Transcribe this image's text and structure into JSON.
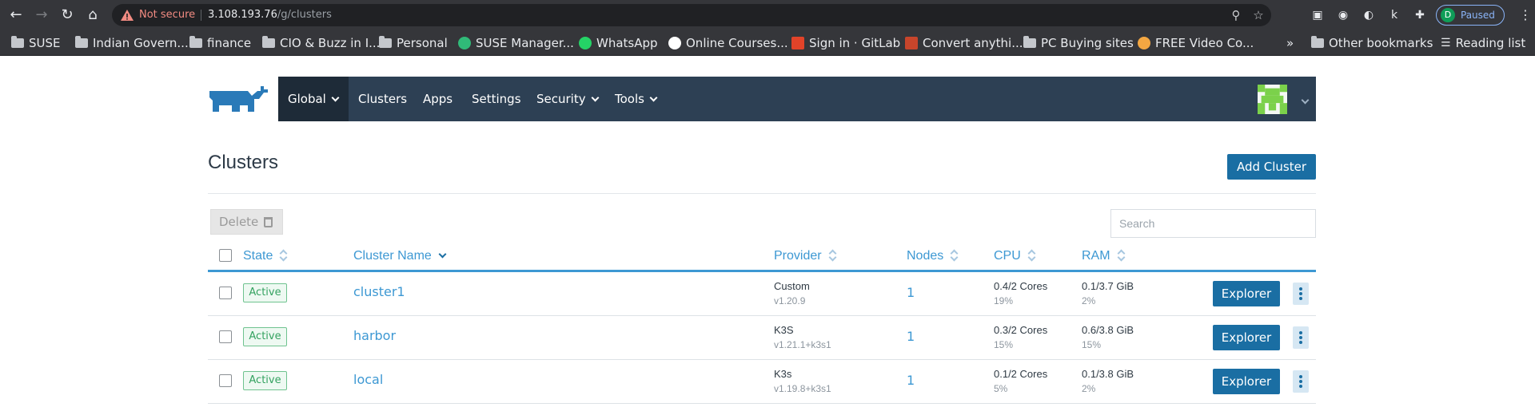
{
  "browser": {
    "security_label": "Not secure",
    "url_host": "3.108.193.76",
    "url_path": "/g/clusters",
    "profile_initial": "D",
    "profile_status": "Paused",
    "bookmarks": [
      {
        "label": "SUSE",
        "icon": "folder-icon"
      },
      {
        "label": "Indian Govern...",
        "icon": "folder-icon"
      },
      {
        "label": "finance",
        "icon": "folder-icon"
      },
      {
        "label": "CIO & Buzz in I...",
        "icon": "folder-icon"
      },
      {
        "label": "Personal",
        "icon": "folder-icon"
      },
      {
        "label": "SUSE Manager...",
        "icon": "suse-icon"
      },
      {
        "label": "WhatsApp",
        "icon": "whatsapp-icon"
      },
      {
        "label": "Online Courses...",
        "icon": "udemy-icon"
      },
      {
        "label": "Sign in · GitLab",
        "icon": "gitlab-icon"
      },
      {
        "label": "Convert anythi...",
        "icon": "pdf-icon"
      },
      {
        "label": "PC Buying sites",
        "icon": "folder-icon"
      },
      {
        "label": "FREE Video Co...",
        "icon": "video-icon"
      }
    ],
    "more_bookmarks": "»",
    "other_bookmarks": "Other bookmarks",
    "reading_list": "Reading list"
  },
  "nav": {
    "global": "Global",
    "clusters": "Clusters",
    "apps": "Apps",
    "settings": "Settings",
    "security": "Security",
    "tools": "Tools"
  },
  "page": {
    "title": "Clusters",
    "add_cluster": "Add Cluster",
    "delete": "Delete",
    "search_placeholder": "Search"
  },
  "table": {
    "headers": {
      "state": "State",
      "cluster_name": "Cluster Name",
      "provider": "Provider",
      "nodes": "Nodes",
      "cpu": "CPU",
      "ram": "RAM"
    },
    "rows": [
      {
        "state": "Active",
        "name": "cluster1",
        "provider": "Custom",
        "version": "v1.20.9",
        "nodes": "1",
        "cpu": "0.4/2 Cores",
        "cpu_pct": "19%",
        "ram": "0.1/3.7 GiB",
        "ram_pct": "2%",
        "action": "Explorer"
      },
      {
        "state": "Active",
        "name": "harbor",
        "provider": "K3S",
        "version": "v1.21.1+k3s1",
        "nodes": "1",
        "cpu": "0.3/2 Cores",
        "cpu_pct": "15%",
        "ram": "0.6/3.8 GiB",
        "ram_pct": "15%",
        "action": "Explorer"
      },
      {
        "state": "Active",
        "name": "local",
        "provider": "K3s",
        "version": "v1.19.8+k3s1",
        "nodes": "1",
        "cpu": "0.1/2 Cores",
        "cpu_pct": "5%",
        "ram": "0.1/3.8 GiB",
        "ram_pct": "2%",
        "action": "Explorer"
      }
    ]
  },
  "colors": {
    "nav_bg": "#2d4054",
    "nav_active": "#1e2b38",
    "primary": "#1a6ea3",
    "link": "#3d98d3",
    "active_badge": "#34a260"
  }
}
